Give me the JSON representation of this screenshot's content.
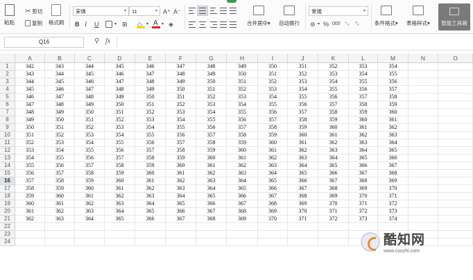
{
  "ribbon": {
    "paste": "粘贴",
    "cut": "剪切",
    "copy": "复制",
    "format_painter": "格式刷",
    "font_name": "宋体",
    "font_size": "11",
    "bold": "B",
    "italic": "I",
    "underline": "U",
    "merge_center": "合并居中",
    "wrap_text": "自动换行",
    "number_format": "常规",
    "cond_format": "条件格式",
    "table_style": "表格样式",
    "smart_toolbox": "智能工具箱",
    "font_color": "#e02020",
    "fill_color": "#f5d000",
    "accent": "#3c9b48"
  },
  "formula_bar": {
    "name_box": "Q16",
    "fx": "fx",
    "formula": ""
  },
  "sheet": {
    "columns": [
      "A",
      "B",
      "C",
      "D",
      "E",
      "F",
      "G",
      "H",
      "I",
      "J",
      "K",
      "L",
      "M",
      "N",
      "O"
    ],
    "rows": [
      "1",
      "2",
      "3",
      "4",
      "5",
      "6",
      "7",
      "8",
      "9",
      "10",
      "11",
      "12",
      "13",
      "14",
      "15",
      "16",
      "17",
      "18",
      "19",
      "20",
      "21",
      "22",
      "23",
      "24"
    ],
    "active_row": "16",
    "cells": [
      [
        "342",
        "343",
        "344",
        "345",
        "346",
        "347",
        "348",
        "349",
        "350",
        "351",
        "352",
        "353",
        "354"
      ],
      [
        "343",
        "344",
        "345",
        "346",
        "347",
        "348",
        "349",
        "350",
        "351",
        "352",
        "353",
        "354",
        "355"
      ],
      [
        "344",
        "345",
        "346",
        "347",
        "348",
        "349",
        "350",
        "351",
        "352",
        "353",
        "354",
        "355",
        "356"
      ],
      [
        "345",
        "346",
        "347",
        "348",
        "349",
        "350",
        "351",
        "352",
        "353",
        "354",
        "355",
        "356",
        "357"
      ],
      [
        "346",
        "347",
        "348",
        "349",
        "350",
        "351",
        "352",
        "353",
        "354",
        "355",
        "356",
        "357",
        "358"
      ],
      [
        "347",
        "348",
        "349",
        "350",
        "351",
        "352",
        "353",
        "354",
        "355",
        "356",
        "357",
        "358",
        "359"
      ],
      [
        "348",
        "349",
        "350",
        "351",
        "352",
        "353",
        "354",
        "355",
        "356",
        "357",
        "358",
        "359",
        "360"
      ],
      [
        "349",
        "350",
        "351",
        "352",
        "353",
        "354",
        "355",
        "356",
        "357",
        "358",
        "359",
        "360",
        "361"
      ],
      [
        "350",
        "351",
        "352",
        "353",
        "354",
        "355",
        "356",
        "357",
        "358",
        "359",
        "360",
        "361",
        "362"
      ],
      [
        "351",
        "352",
        "353",
        "354",
        "355",
        "356",
        "357",
        "358",
        "359",
        "360",
        "361",
        "362",
        "363"
      ],
      [
        "352",
        "353",
        "354",
        "355",
        "356",
        "357",
        "358",
        "359",
        "360",
        "361",
        "362",
        "363",
        "364"
      ],
      [
        "353",
        "354",
        "355",
        "356",
        "357",
        "358",
        "359",
        "360",
        "361",
        "362",
        "363",
        "364",
        "365"
      ],
      [
        "354",
        "355",
        "356",
        "357",
        "358",
        "359",
        "360",
        "361",
        "362",
        "363",
        "364",
        "365",
        "366"
      ],
      [
        "355",
        "356",
        "357",
        "358",
        "359",
        "360",
        "361",
        "362",
        "363",
        "364",
        "365",
        "366",
        "367"
      ],
      [
        "356",
        "357",
        "358",
        "359",
        "360",
        "361",
        "362",
        "363",
        "364",
        "365",
        "366",
        "367",
        "368"
      ],
      [
        "357",
        "358",
        "359",
        "360",
        "361",
        "362",
        "363",
        "364",
        "365",
        "366",
        "367",
        "368",
        "369"
      ],
      [
        "358",
        "359",
        "360",
        "361",
        "362",
        "363",
        "364",
        "365",
        "366",
        "367",
        "368",
        "369",
        "370"
      ],
      [
        "359",
        "360",
        "361",
        "362",
        "363",
        "364",
        "365",
        "366",
        "367",
        "368",
        "369",
        "370",
        "371"
      ],
      [
        "360",
        "361",
        "362",
        "363",
        "364",
        "365",
        "366",
        "367",
        "368",
        "369",
        "370",
        "371",
        "372"
      ],
      [
        "361",
        "362",
        "363",
        "364",
        "365",
        "366",
        "367",
        "368",
        "369",
        "370",
        "371",
        "372",
        "373"
      ],
      [
        "362",
        "363",
        "364",
        "365",
        "366",
        "367",
        "368",
        "369",
        "370",
        "371",
        "372",
        "373",
        "374"
      ]
    ]
  },
  "watermark": {
    "title": "酷知网",
    "url": "www.coozhi.com"
  }
}
